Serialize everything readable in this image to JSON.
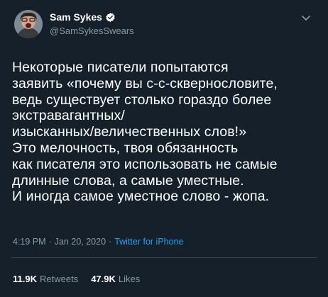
{
  "author": {
    "display_name": "Sam Sykes",
    "handle": "@SamSykesSwears",
    "verified_icon": "verified-badge-icon",
    "avatar_icon": "avatar"
  },
  "tweet": {
    "text": "Некоторые писатели попытаются\nзаявить «почему вы с-с-сквернословите,\nведь существует столько гораздо более\nэкстравагантных/\nизысканных/величественных слов!»\nЭто мелочность, твоя обязанность\nкак писателя это использовать не самые\nдлинные слова, а самые уместные.\nИ иногда самое уместное слово - жопа."
  },
  "meta": {
    "time": "4:19 PM",
    "separator": "·",
    "date": "Jan 20, 2020",
    "source": "Twitter for iPhone"
  },
  "stats": {
    "retweets_count": "11.9K",
    "retweets_label": "Retweets",
    "likes_count": "47.9K",
    "likes_label": "Likes"
  },
  "colors": {
    "background": "#15202b",
    "secondary_text": "#8899a6",
    "accent": "#1da1f2",
    "divider": "#38444d"
  }
}
